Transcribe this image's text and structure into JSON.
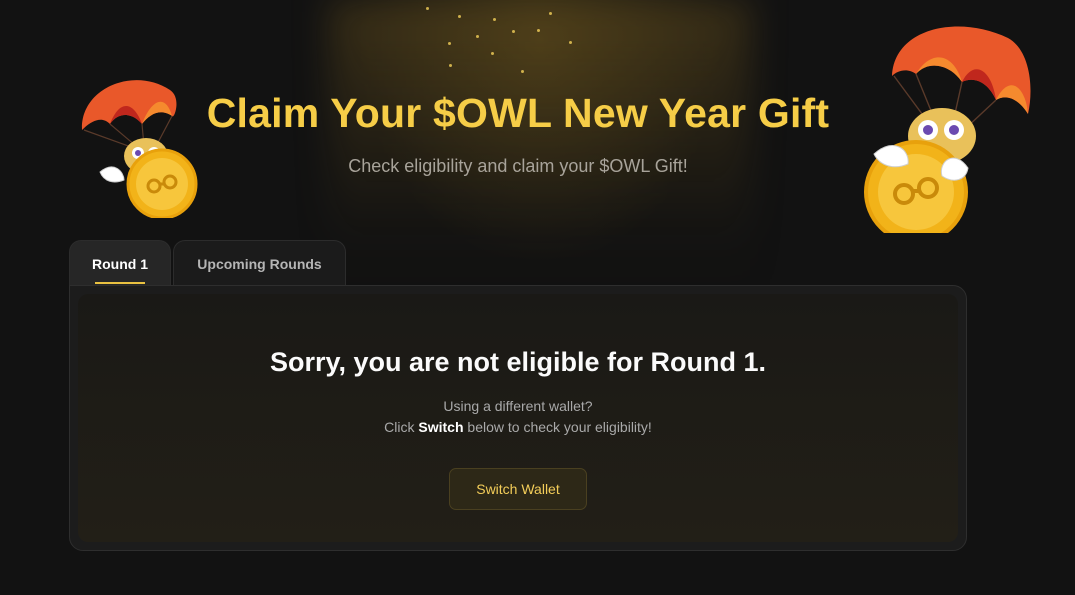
{
  "header": {
    "title": "Claim Your $OWL New Year Gift",
    "subtitle": "Check eligibility and claim your $OWL Gift!"
  },
  "tabs": [
    {
      "label": "Round 1",
      "active": true
    },
    {
      "label": "Upcoming Rounds",
      "active": false
    }
  ],
  "panel": {
    "headline": "Sorry, you are not eligible for Round 1.",
    "line1": "Using a different wallet?",
    "line2_prefix": "Click ",
    "line2_bold": "Switch",
    "line2_suffix": " below to check your eligibility!",
    "button_label": "Switch Wallet"
  },
  "colors": {
    "accent": "#f6cd47",
    "background": "#121212",
    "panel": "#1c1c1c"
  },
  "icons": [
    "owl-parachute-mascot-icon",
    "owl-parachute-mascot-icon"
  ]
}
